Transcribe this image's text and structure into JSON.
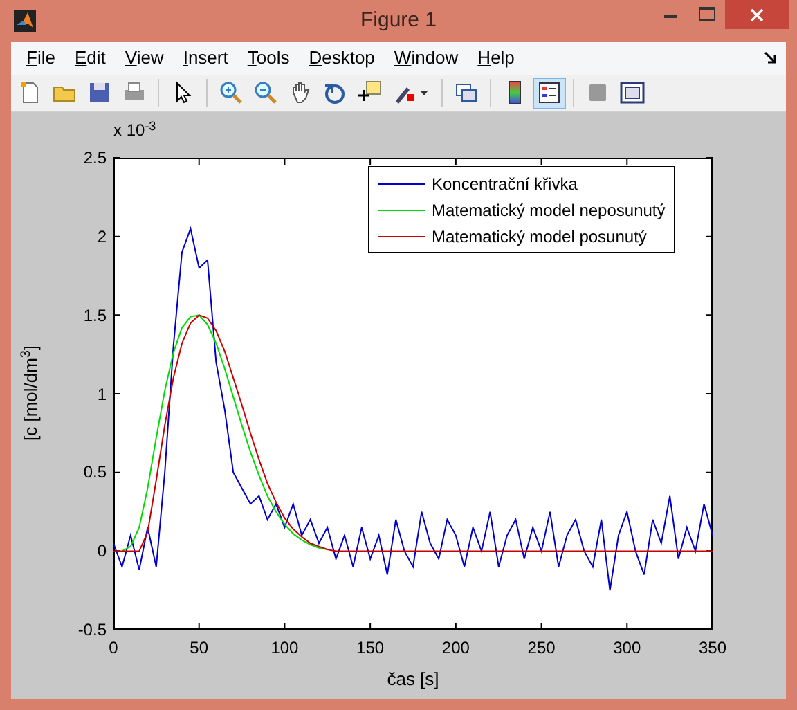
{
  "window": {
    "title": "Figure 1"
  },
  "menu": [
    "File",
    "Edit",
    "View",
    "Insert",
    "Tools",
    "Desktop",
    "Window",
    "Help"
  ],
  "toolbar": [
    {
      "kind": "new",
      "selected": false
    },
    {
      "kind": "open",
      "selected": false
    },
    {
      "kind": "save",
      "selected": false
    },
    {
      "kind": "print",
      "selected": false
    },
    {
      "kind": "sep"
    },
    {
      "kind": "pointer",
      "selected": false
    },
    {
      "kind": "sep"
    },
    {
      "kind": "zoom-in",
      "selected": false
    },
    {
      "kind": "zoom-out",
      "selected": false
    },
    {
      "kind": "pan",
      "selected": false
    },
    {
      "kind": "rotate",
      "selected": false
    },
    {
      "kind": "data-cursor",
      "selected": false
    },
    {
      "kind": "brush",
      "selected": false
    },
    {
      "kind": "sep"
    },
    {
      "kind": "link",
      "selected": false
    },
    {
      "kind": "sep"
    },
    {
      "kind": "colorbar",
      "selected": false
    },
    {
      "kind": "legend",
      "selected": true
    },
    {
      "kind": "sep"
    },
    {
      "kind": "hide-tools",
      "selected": false
    },
    {
      "kind": "show-tools",
      "selected": false
    }
  ],
  "figure": {
    "exponent_label": "x 10$^{-3}$",
    "chart_data": {
      "type": "line",
      "legend": true,
      "xlabel": "čas [s]",
      "ylabel": "[c [mol/dm$^{3}$]",
      "xlim": [
        0,
        350
      ],
      "ylim": [
        -0.5,
        2.5
      ],
      "xticks": [
        0,
        50,
        100,
        150,
        200,
        250,
        300,
        350
      ],
      "yticks": [
        -0.5,
        0,
        0.5,
        1,
        1.5,
        2,
        2.5
      ],
      "x": [
        0,
        5,
        10,
        15,
        20,
        25,
        30,
        35,
        40,
        45,
        50,
        55,
        60,
        65,
        70,
        75,
        80,
        85,
        90,
        95,
        100,
        105,
        110,
        115,
        120,
        125,
        130,
        135,
        140,
        145,
        150,
        155,
        160,
        165,
        170,
        175,
        180,
        185,
        190,
        195,
        200,
        205,
        210,
        215,
        220,
        225,
        230,
        235,
        240,
        245,
        250,
        255,
        260,
        265,
        270,
        275,
        280,
        285,
        290,
        295,
        300,
        305,
        310,
        315,
        320,
        325,
        330,
        335,
        340,
        345,
        350
      ],
      "series": [
        {
          "name": "Koncentrační křivka",
          "color": "#0000c8",
          "values": [
            0.05,
            -0.1,
            0.1,
            -0.12,
            0.15,
            -0.1,
            0.5,
            1.3,
            1.9,
            2.05,
            1.8,
            1.85,
            1.2,
            0.9,
            0.5,
            0.4,
            0.3,
            0.35,
            0.2,
            0.3,
            0.15,
            0.3,
            0.1,
            0.2,
            0.05,
            0.15,
            -0.05,
            0.1,
            -0.1,
            0.15,
            -0.05,
            0.1,
            -0.15,
            0.2,
            0.0,
            -0.1,
            0.25,
            0.05,
            -0.05,
            0.2,
            0.1,
            -0.1,
            0.15,
            0.0,
            0.25,
            -0.1,
            0.1,
            0.2,
            -0.05,
            0.15,
            0.0,
            0.25,
            -0.1,
            0.1,
            0.2,
            0.0,
            -0.1,
            0.2,
            -0.25,
            0.1,
            0.25,
            0.0,
            -0.15,
            0.2,
            0.05,
            0.35,
            -0.05,
            0.15,
            0.0,
            0.3,
            0.1
          ]
        },
        {
          "name": "Matematický model neposunutý",
          "color": "#00dc00",
          "values": [
            null,
            0,
            0.03,
            0.15,
            0.4,
            0.72,
            1.02,
            1.26,
            1.42,
            1.49,
            1.5,
            1.44,
            1.32,
            1.16,
            0.98,
            0.8,
            0.63,
            0.48,
            0.35,
            0.25,
            0.17,
            0.11,
            0.07,
            0.04,
            0.02,
            0.01,
            null,
            null,
            null,
            null,
            null,
            null,
            null,
            null,
            null,
            null,
            null,
            null,
            null,
            null,
            null,
            null,
            null,
            null,
            null,
            null,
            null,
            null,
            null,
            null,
            null,
            null,
            null,
            null,
            null,
            null,
            null,
            null,
            null,
            null,
            null,
            null,
            null,
            null,
            null,
            null,
            null,
            null,
            null,
            null,
            null
          ]
        },
        {
          "name": "Matematický model posunutý",
          "color": "#c80000",
          "values": [
            0,
            0,
            0,
            0,
            0.12,
            0.45,
            0.8,
            1.1,
            1.32,
            1.45,
            1.5,
            1.48,
            1.4,
            1.27,
            1.1,
            0.93,
            0.75,
            0.58,
            0.43,
            0.31,
            0.21,
            0.14,
            0.09,
            0.05,
            0.03,
            0.01,
            0,
            0,
            0,
            0,
            0,
            0,
            0,
            0,
            0,
            0,
            0,
            0,
            0,
            0,
            0,
            0,
            0,
            0,
            0,
            0,
            0,
            0,
            0,
            0,
            0,
            0,
            0,
            0,
            0,
            0,
            0,
            0,
            0,
            0,
            0,
            0,
            0,
            0,
            0,
            0,
            0,
            0,
            0,
            0,
            0
          ]
        }
      ]
    }
  }
}
